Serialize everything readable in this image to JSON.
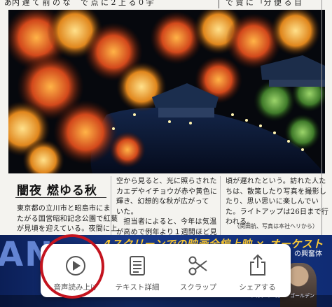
{
  "article": {
    "top_left_text": "あ内 遅 て 前 の な　 で 点 に 2 上 る 0 宇",
    "top_right_text": "で 賀 に 「分 便 る 目",
    "headline": "闇夜 燃ゆる秋",
    "col_a": [
      "東京都の立川市と昭島市にま",
      "たがる国営昭和記念公園で紅葉",
      "が見頃を迎えている。夜間に上"
    ],
    "col_b": [
      "空から見ると、光に照らされた",
      "カエデやイチョウが赤や黄色に",
      "輝き、幻想的な秋が広がって",
      "いた。",
      "　担当者によると、今年は気温",
      "が高めで例年より１週間ほど見"
    ],
    "col_c": [
      "頃が遅れたという。訪れた人た",
      "ちは、散策したり写真を撮影し",
      "たり、思い思いに楽しんでい",
      "た。ライトアップは26日まで行",
      "われる。"
    ],
    "photo_credit": "（関田航、写真は本社ヘリから）"
  },
  "banner": {
    "title": "4スクリーンでの映画全編上映 × オーケスト",
    "big_text": "AN",
    "sub_text": "の興奮体",
    "small_text": "アカデミー賞®・ゴールデン"
  },
  "toolbar": {
    "items": [
      {
        "label": "音声読み上げ",
        "icon": "play-circle-icon"
      },
      {
        "label": "テキスト詳細",
        "icon": "document-icon"
      },
      {
        "label": "スクラップ",
        "icon": "scissors-icon"
      },
      {
        "label": "シェアする",
        "icon": "share-icon"
      }
    ]
  },
  "highlight": {
    "color": "#c4141f",
    "target": "音声読み上げ"
  }
}
